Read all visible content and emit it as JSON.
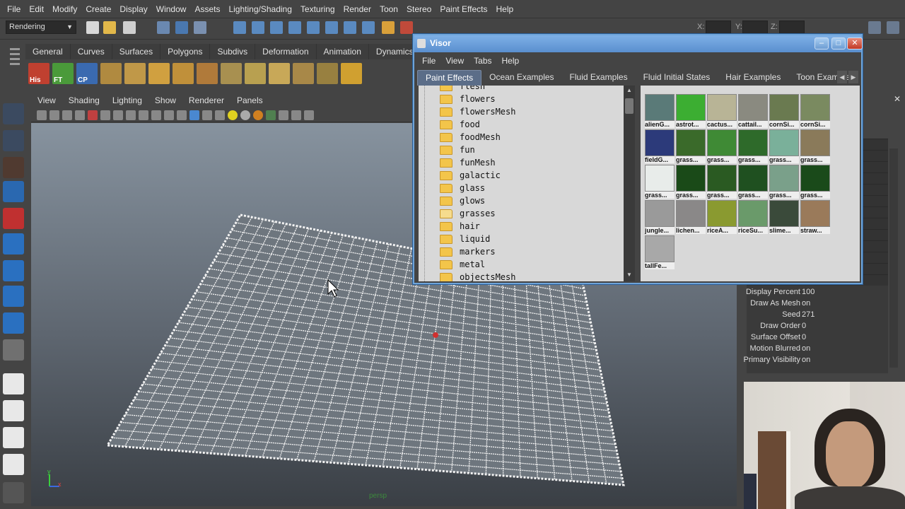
{
  "menubar": {
    "items": [
      "File",
      "Edit",
      "Modify",
      "Create",
      "Display",
      "Window",
      "Assets",
      "Lighting/Shading",
      "Texturing",
      "Render",
      "Toon",
      "Stereo",
      "Paint Effects",
      "Help"
    ]
  },
  "statusline": {
    "mode": "Rendering",
    "snap_labels": [
      "X:",
      "Y:",
      "Z:"
    ]
  },
  "shelf": {
    "tabs": [
      "General",
      "Curves",
      "Surfaces",
      "Polygons",
      "Subdivs",
      "Deformation",
      "Animation",
      "Dynamics"
    ],
    "icon_labels": [
      "His",
      "FT",
      "CP"
    ]
  },
  "panel": {
    "menus": [
      "View",
      "Shading",
      "Lighting",
      "Show",
      "Renderer",
      "Panels"
    ],
    "camera_label": "persp"
  },
  "visor": {
    "title": "Visor",
    "menus": [
      "File",
      "View",
      "Tabs",
      "Help"
    ],
    "tabs": [
      "Paint Effects",
      "Ocean Examples",
      "Fluid Examples",
      "Fluid Initial States",
      "Hair Examples",
      "Toon Examples"
    ],
    "active_tab": "Paint Effects",
    "folders": [
      "flesh",
      "flowers",
      "flowersMesh",
      "food",
      "foodMesh",
      "fun",
      "funMesh",
      "galactic",
      "glass",
      "glows",
      "grasses",
      "hair",
      "liquid",
      "markers",
      "metal",
      "objectsMesh"
    ],
    "selected_folder": "grasses",
    "thumbnails": [
      {
        "label": "alienG...",
        "color": "#5a7a78"
      },
      {
        "label": "astrot...",
        "color": "#3cae32"
      },
      {
        "label": "cactus...",
        "color": "#b8b496"
      },
      {
        "label": "cattail...",
        "color": "#8a8a80"
      },
      {
        "label": "cornSi...",
        "color": "#6a7a50"
      },
      {
        "label": "cornSi...",
        "color": "#7a8a60"
      },
      {
        "label": "fieldG...",
        "color": "#2c3a7a"
      },
      {
        "label": "grass...",
        "color": "#3a6a2a"
      },
      {
        "label": "grass...",
        "color": "#3f8a35"
      },
      {
        "label": "grass...",
        "color": "#2e6a2a"
      },
      {
        "label": "grass...",
        "color": "#7ab09a"
      },
      {
        "label": "grass...",
        "color": "#8a7a5a"
      },
      {
        "label": "grass...",
        "color": "#e8ecea"
      },
      {
        "label": "grass...",
        "color": "#1a4a18"
      },
      {
        "label": "grass...",
        "color": "#2a5a22"
      },
      {
        "label": "grass...",
        "color": "#1f5020"
      },
      {
        "label": "grass...",
        "color": "#7aa08a"
      },
      {
        "label": "grass...",
        "color": "#1a4a1a"
      },
      {
        "label": "jungle...",
        "color": "#9a9a9a"
      },
      {
        "label": "lichen...",
        "color": "#8a8888"
      },
      {
        "label": "riceA...",
        "color": "#8a9a30"
      },
      {
        "label": "riceSu...",
        "color": "#6a9a6a"
      },
      {
        "label": "slime...",
        "color": "#3a4a3a"
      },
      {
        "label": "straw...",
        "color": "#9a7a5a"
      },
      {
        "label": "tallFe...",
        "color": "#a8a8a8"
      }
    ]
  },
  "channel_box": {
    "rows": [
      {
        "label": "Display Percent",
        "value": "100"
      },
      {
        "label": "Draw As Mesh",
        "value": "on"
      },
      {
        "label": "Seed",
        "value": "271"
      },
      {
        "label": "Draw Order",
        "value": "0"
      },
      {
        "label": "Surface Offset",
        "value": "0"
      },
      {
        "label": "Motion Blurred",
        "value": "on"
      },
      {
        "label": "Primary Visibility",
        "value": "on"
      }
    ]
  },
  "colors": {
    "visor_title": "#5a8fcf",
    "folder_icon": "#f3c54a",
    "viewport_top": "#87939f"
  }
}
